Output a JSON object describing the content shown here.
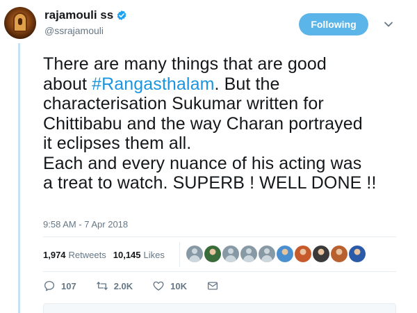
{
  "author": {
    "display_name": "rajamouli ss",
    "handle": "@ssrajamouli",
    "verified": true
  },
  "follow_button": {
    "label": "Following"
  },
  "tweet": {
    "lines": [
      {
        "segments": [
          {
            "text": "There are many things that are good",
            "type": "text"
          }
        ]
      },
      {
        "segments": [
          {
            "text": "about ",
            "type": "text"
          },
          {
            "text": "#Rangasthalam",
            "type": "hashtag"
          },
          {
            "text": ". But the",
            "type": "text"
          }
        ]
      },
      {
        "segments": [
          {
            "text": "characterisation Sukumar written for",
            "type": "text"
          }
        ]
      },
      {
        "segments": [
          {
            "text": "Chittibabu and the way Charan portrayed",
            "type": "text"
          }
        ]
      },
      {
        "segments": [
          {
            "text": "it eclipses them all.",
            "type": "text"
          }
        ]
      },
      {
        "segments": [
          {
            "text": "Each and every nuance of his acting was",
            "type": "text"
          }
        ]
      },
      {
        "segments": [
          {
            "text": "a treat to watch. SUPERB ! WELL DONE !!",
            "type": "text"
          }
        ]
      }
    ],
    "timestamp": "9:58 AM - 7 Apr 2018"
  },
  "stats": {
    "retweets_count": "1,974",
    "retweets_label": "Retweets",
    "likes_count": "10,145",
    "likes_label": "Likes"
  },
  "likers": [
    {
      "kind": "default",
      "color": "#8899a6"
    },
    {
      "kind": "photo",
      "color": "#3a6b3a"
    },
    {
      "kind": "default",
      "color": "#8899a6"
    },
    {
      "kind": "default",
      "color": "#8899a6"
    },
    {
      "kind": "default",
      "color": "#8899a6"
    },
    {
      "kind": "photo",
      "color": "#4a8fd0"
    },
    {
      "kind": "photo",
      "color": "#c65a2a"
    },
    {
      "kind": "photo",
      "color": "#3a3a3a"
    },
    {
      "kind": "photo",
      "color": "#b8602e"
    },
    {
      "kind": "photo",
      "color": "#2a5aa8"
    }
  ],
  "actions": {
    "reply_count": "107",
    "retweet_count": "2.0K",
    "like_count": "10K"
  },
  "colors": {
    "accent": "#1b95e0",
    "follow_bg": "#5bb5e8",
    "muted": "#657786",
    "thread_line": "#c4e2f3"
  }
}
